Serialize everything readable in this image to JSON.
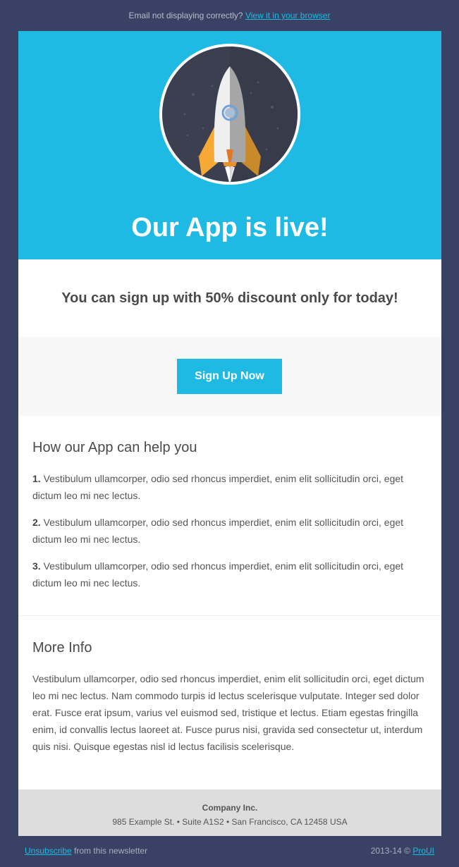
{
  "topbar": {
    "text": "Email not displaying correctly?",
    "link": "View it in your browser"
  },
  "hero": {
    "title": "Our App is live!",
    "icon": "rocket-icon"
  },
  "discount": {
    "text": "You can sign up with 50% discount only for today!"
  },
  "cta": {
    "label": "Sign Up Now"
  },
  "help": {
    "heading": "How our App can help you",
    "items": [
      {
        "num": "1.",
        "text": "Vestibulum ullamcorper, odio sed rhoncus imperdiet, enim elit sollicitudin orci, eget dictum leo mi nec lectus."
      },
      {
        "num": "2.",
        "text": "Vestibulum ullamcorper, odio sed rhoncus imperdiet, enim elit sollicitudin orci, eget dictum leo mi nec lectus."
      },
      {
        "num": "3.",
        "text": "Vestibulum ullamcorper, odio sed rhoncus imperdiet, enim elit sollicitudin orci, eget dictum leo mi nec lectus."
      }
    ]
  },
  "info": {
    "heading": "More Info",
    "text": "Vestibulum ullamcorper, odio sed rhoncus imperdiet, enim elit sollicitudin orci, eget dictum leo mi nec lectus. Nam commodo turpis id lectus scelerisque vulputate. Integer sed dolor erat. Fusce erat ipsum, varius vel euismod sed, tristique et lectus. Etiam egestas fringilla enim, id convallis lectus laoreet at. Fusce purus nisi, gravida sed consectetur ut, interdum quis nisi. Quisque egestas nisl id lectus facilisis scelerisque."
  },
  "footer": {
    "company": "Company Inc.",
    "address": "985 Example St. • Suite A1S2 • San Francisco, CA 12458 USA"
  },
  "bottombar": {
    "unsubscribe": "Unsubscribe",
    "unsubscribe_suffix": " from this newsletter",
    "copyright": "2013-14 ©",
    "brand": "ProUI"
  },
  "colors": {
    "background": "#394264",
    "accent": "#1ebae3",
    "footer": "#dddddd"
  }
}
